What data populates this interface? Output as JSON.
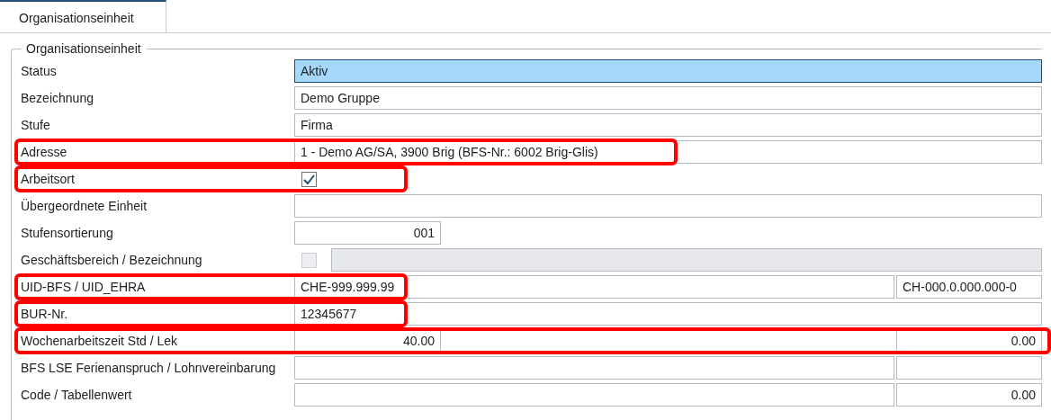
{
  "tabs": [
    {
      "label": "Organisationseinheit",
      "selected": true
    }
  ],
  "group": {
    "title": "Organisationseinheit"
  },
  "rows": [
    {
      "label": "Status",
      "fields": [
        {
          "kind": "select",
          "value": "Aktiv",
          "focused": true
        }
      ]
    },
    {
      "label": "Bezeichnung",
      "fields": [
        {
          "kind": "text",
          "value": "Demo Gruppe"
        }
      ]
    },
    {
      "label": "Stufe",
      "fields": [
        {
          "kind": "text",
          "value": "Firma"
        }
      ]
    },
    {
      "label": "Adresse",
      "highlight": {
        "kind": "medium"
      },
      "fields": [
        {
          "kind": "text",
          "value": "1 - Demo AG/SA, 3900 Brig (BFS-Nr.: 6002 Brig-Glis)"
        }
      ]
    },
    {
      "label": "Arbeitsort",
      "highlight": {
        "kind": "short"
      },
      "fields": [
        {
          "kind": "checkbox",
          "checked": true,
          "disabled": false
        }
      ]
    },
    {
      "label": "Übergeordnete Einheit",
      "fields": [
        {
          "kind": "text"
        }
      ]
    },
    {
      "label": "Stufensortierung",
      "fields": [
        {
          "kind": "number",
          "value": "001"
        }
      ]
    },
    {
      "label": "Geschäftsbereich / Bezeichnung",
      "fields": [
        {
          "kind": "checkbox",
          "checked": false,
          "disabled": true
        },
        {
          "kind": "text",
          "disabled": true
        }
      ]
    },
    {
      "label": "UID-BFS / UID_EHRA",
      "highlight": {
        "kind": "short"
      },
      "fields": [
        {
          "kind": "text",
          "value": "CHE-999.999.99"
        },
        {
          "kind": "text",
          "value": "CH-000.0.000.000-0"
        }
      ]
    },
    {
      "label": "BUR-Nr.",
      "highlight": {
        "kind": "short"
      },
      "fields": [
        {
          "kind": "text",
          "value": "12345677"
        }
      ]
    },
    {
      "label": "Wochenarbeitszeit Std / Lek",
      "highlight": {
        "kind": "full"
      },
      "fields": [
        {
          "kind": "number",
          "value": "40.00"
        },
        {
          "kind": "blank"
        },
        {
          "kind": "number",
          "value": "0.00"
        }
      ]
    },
    {
      "label": "BFS LSE Ferienanspruch / Lohnvereinbarung",
      "fields": [
        {
          "kind": "text"
        },
        {
          "kind": "text"
        }
      ]
    },
    {
      "label": "Code / Tabellenwert",
      "fields": [
        {
          "kind": "text"
        },
        {
          "kind": "number",
          "value": "0.00"
        }
      ]
    }
  ]
}
